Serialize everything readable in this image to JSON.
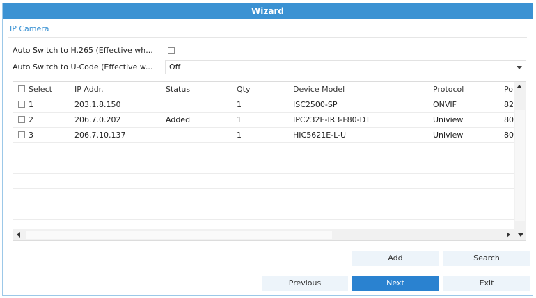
{
  "window": {
    "title": "Wizard"
  },
  "section": {
    "title": "IP Camera"
  },
  "options": {
    "h265_label": "Auto Switch to H.265 (Effective wh...",
    "h265_checked": false,
    "ucode_label": "Auto Switch to U-Code (Effective w...",
    "ucode_value": "Off"
  },
  "table": {
    "headers": {
      "select": "Select",
      "ip": "IP Addr.",
      "status": "Status",
      "qty": "Qty",
      "model": "Device Model",
      "protocol": "Protocol",
      "port": "Po"
    },
    "rows": [
      {
        "index": "1",
        "ip": "203.1.8.150",
        "status": "",
        "qty": "1",
        "model": "ISC2500-SP",
        "protocol": "ONVIF",
        "port": "82"
      },
      {
        "index": "2",
        "ip": "206.7.0.202",
        "status": "Added",
        "qty": "1",
        "model": "IPC232E-IR3-F80-DT",
        "protocol": "Uniview",
        "port": "80"
      },
      {
        "index": "3",
        "ip": "206.7.10.137",
        "status": "",
        "qty": "1",
        "model": "HIC5621E-L-U",
        "protocol": "Uniview",
        "port": "80"
      }
    ]
  },
  "buttons": {
    "add": "Add",
    "search": "Search",
    "previous": "Previous",
    "next": "Next",
    "exit": "Exit"
  },
  "colors": {
    "titlebar": "#3b92d3",
    "primary_button": "#2a82d0",
    "secondary_button": "#edf4fa"
  }
}
